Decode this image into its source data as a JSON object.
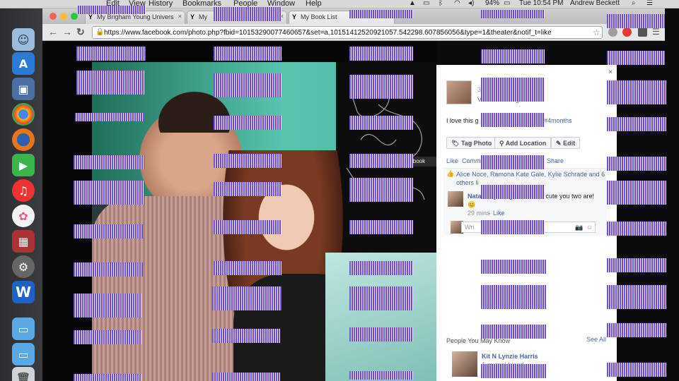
{
  "menubar": {
    "items": [
      "Edit",
      "View",
      "History",
      "Bookmarks",
      "People",
      "Window",
      "Help"
    ],
    "battery": "94%",
    "clock": "Tue 10:54 PM",
    "user": "Andrew Beckett"
  },
  "browser": {
    "tabs": [
      {
        "label": "My Brigham Young Univers",
        "favicon": "Y",
        "close": "×"
      },
      {
        "label": "My",
        "favicon": "Y",
        "close": "×"
      },
      {
        "label": "My Book List",
        "favicon": "Y",
        "close": ""
      }
    ],
    "url": "https://www.facebook.com/photo.php?fbid=10153290077460657&set=a.10151412520921057.542298.607856056&type=1&theater&notif_t=like",
    "nav": {
      "back": "←",
      "forward": "→",
      "reload": "↻"
    }
  },
  "photo_view": {
    "facebook_tab": "Facebook"
  },
  "sidebar": {
    "close": "×",
    "date_fragment": "3",
    "via": "View on Instagram",
    "caption_start": "I love this g",
    "caption_end": "#4months",
    "buttons": {
      "tag": "Tag Photo",
      "location": "Add Location",
      "edit": "Edit"
    },
    "actions": {
      "like": "Like",
      "comment": "Comm",
      "share": "Share"
    },
    "likes_text": "Alice Noce, Ramona Kate Gale, Kylie Schrade and 6",
    "likes_text_2": "others li",
    "comment": {
      "author": "Natalie Jyoung Kwon",
      "text": "How cute you two are!",
      "emoji": "😊",
      "time": "29 mins",
      "like": "Like"
    },
    "comment_placeholder": "Wri",
    "people_you_may_know": "People You May Know",
    "see_all": "See All",
    "suggestion": {
      "name": "Kit N Lynzie Harris",
      "mutual": "1 mutual friend"
    }
  },
  "colors": {
    "facebook_link": "#4b67a1",
    "wall_teal": "#58c4ad",
    "glitch_purple": "#6a5acd"
  }
}
